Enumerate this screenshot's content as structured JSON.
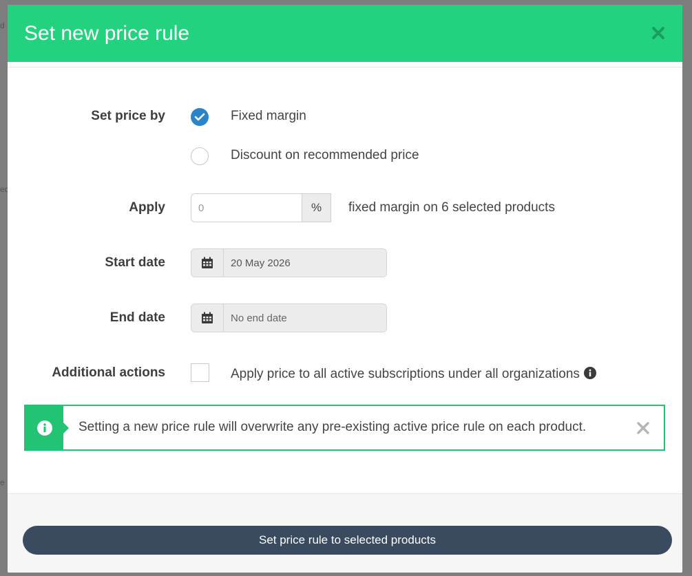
{
  "background": {
    "fragments": [
      "d",
      "ec",
      "e"
    ]
  },
  "modal": {
    "title": "Set new price rule",
    "close_icon": "close-icon"
  },
  "form": {
    "set_price_by": {
      "label": "Set price by",
      "options": [
        {
          "label": "Fixed margin",
          "selected": true
        },
        {
          "label": "Discount on recommended price",
          "selected": false
        }
      ]
    },
    "apply": {
      "label": "Apply",
      "value": "",
      "placeholder": "0",
      "unit": "%",
      "suffix_text": "fixed margin on 6 selected products"
    },
    "start_date": {
      "label": "Start date",
      "value": "20 May 2026",
      "icon": "calendar-icon"
    },
    "end_date": {
      "label": "End date",
      "value": "",
      "placeholder": "No end date",
      "icon": "calendar-icon"
    },
    "additional_actions": {
      "label": "Additional actions",
      "checkbox_label": "Apply price to all active subscriptions under all organizations",
      "checked": false,
      "info_icon": "info-icon"
    }
  },
  "alert": {
    "icon": "info-icon",
    "text": "Setting a new price rule will overwrite any pre-existing active price rule on each product.",
    "close_icon": "close-icon"
  },
  "footer": {
    "submit_label": "Set price rule to selected products"
  },
  "colors": {
    "header": "#22d27e",
    "radio_selected": "#2a84c7",
    "alert_border": "#22c372",
    "button": "#3b4b5f"
  }
}
